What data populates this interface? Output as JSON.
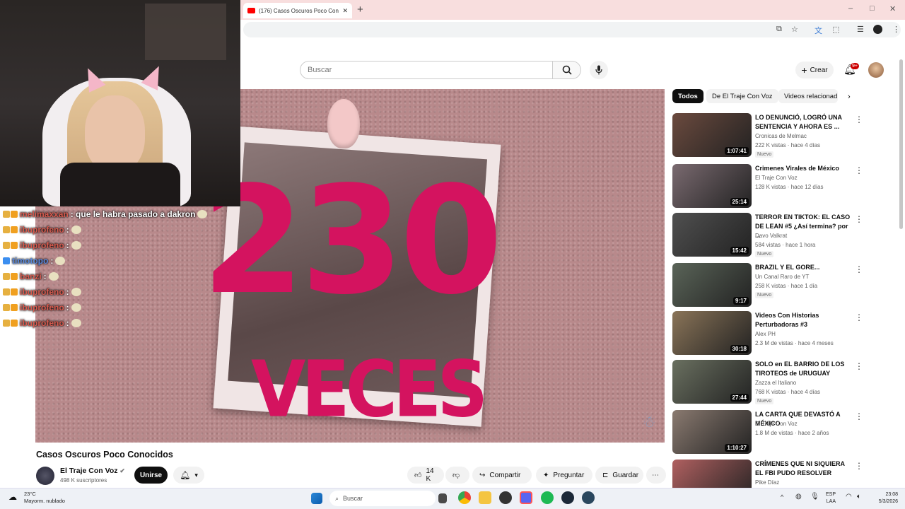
{
  "browser": {
    "tab_title": "(176) Casos Oscuros Poco Conocidos - YouTube",
    "new_tab": "+",
    "win_min": "–",
    "win_max": "□",
    "win_close": "✕"
  },
  "youtube": {
    "search_placeholder": "Buscar",
    "create_label": "Crear",
    "notif_badge": "9+"
  },
  "stream_chat": [
    {
      "user": "melimaxxan",
      "msg": ": que le habra pasado a dakron",
      "color": "red"
    },
    {
      "user": "ibuprofeno",
      "msg": ":",
      "color": "red"
    },
    {
      "user": "ibuprofeno",
      "msg": ":",
      "color": "red"
    },
    {
      "user": "timotopo",
      "msg": ":",
      "color": "blue"
    },
    {
      "user": "banzi",
      "msg": ":",
      "color": "red"
    },
    {
      "user": "ibuprofeno",
      "msg": ":",
      "color": "red"
    },
    {
      "user": "ibuprofeno",
      "msg": ":",
      "color": "red"
    },
    {
      "user": "ibuprofeno",
      "msg": ":",
      "color": "red"
    }
  ],
  "video": {
    "overlay_number": "230",
    "overlay_word": "VECES",
    "title": "Casos Oscuros Poco Conocidos",
    "channel": "El Traje Con Voz",
    "subscribers": "498 K suscriptores",
    "join_label": "Unirse",
    "likes": "14 K",
    "share_label": "Compartir",
    "ask_label": "Preguntar",
    "save_label": "Guardar"
  },
  "chips": [
    "Todos",
    "De El Traje Con Voz",
    "Videos relacionad"
  ],
  "recommendations": [
    {
      "title": "LO DENUNCIÓ, LOGRÓ UNA SENTENCIA Y AHORA ES ...",
      "channel": "Cronicas de Melmac",
      "meta": "222 K vistas · hace 4 días",
      "badge": "Nuevo",
      "duration": "1:07:41",
      "color": "#6b4a3e"
    },
    {
      "title": "Crimenes Virales de México",
      "channel": "El Traje Con Voz",
      "meta": "128 K vistas · hace 12 días",
      "badge": "",
      "duration": "25:14",
      "color": "#7a6a70"
    },
    {
      "title": "TERROR EN TIKTOK: EL CASO DE LEAN #5 ¿Así termina? por ...",
      "channel": "Davo Valkrat",
      "meta": "584 vistas · hace 1 hora",
      "badge": "Nuevo",
      "duration": "15:42",
      "color": "#505050"
    },
    {
      "title": "BRAZIL Y EL GORE...",
      "channel": "Un Canal Raro de YT",
      "meta": "258 K vistas · hace 1 día",
      "badge": "Nuevo",
      "duration": "9:17",
      "color": "#5a6458"
    },
    {
      "title": "Videos Con Historias Perturbadoras #3",
      "channel": "Alex PH",
      "meta": "2.3 M de vistas · hace 4 meses",
      "badge": "",
      "duration": "30:18",
      "color": "#8a7458"
    },
    {
      "title": "SOLO en EL BARRIO DE LOS TIROTEOS de URUGUAY",
      "channel": "Zazza el Italiano",
      "meta": "768 K vistas · hace 4 días",
      "badge": "Nuevo",
      "duration": "27:44",
      "color": "#6a7060"
    },
    {
      "title": "LA CARTA QUE DEVASTÓ A MÉXICO",
      "channel": "El Traje Con Voz",
      "meta": "1.8 M de vistas · hace 2 años",
      "badge": "",
      "duration": "1:10:27",
      "color": "#8a7a70"
    },
    {
      "title": "CRÍMENES QUE NI SIQUIERA EL FBI PUDO RESOLVER",
      "channel": "Pike Díaz",
      "meta": "",
      "badge": "",
      "duration": "",
      "color": "#b06060"
    }
  ],
  "taskbar": {
    "temp": "23°C",
    "weather": "Mayorm. nublado",
    "search": "Buscar",
    "lang1": "ESP",
    "lang2": "LAA",
    "time": "23:08",
    "date": "5/3/2026"
  }
}
